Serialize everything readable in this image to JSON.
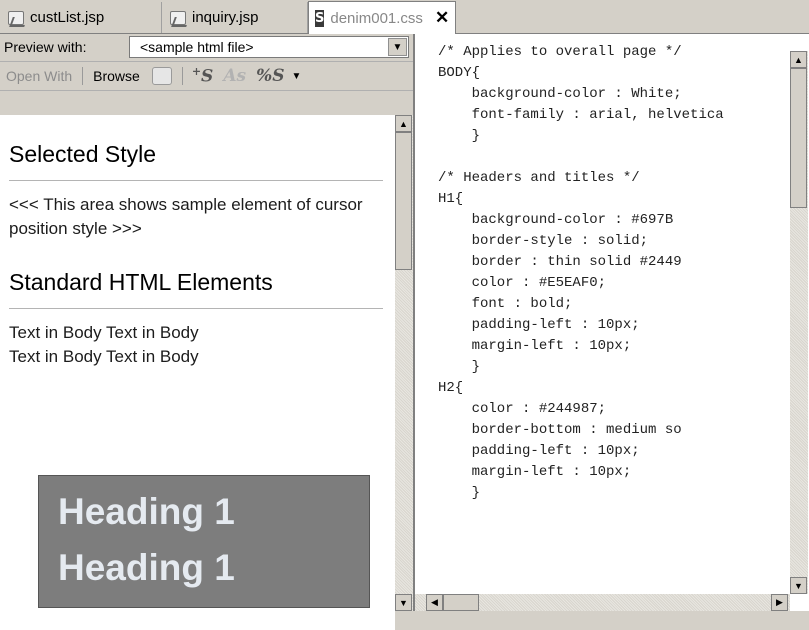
{
  "tabs": [
    {
      "label": "custList.jsp",
      "icon": "jsp-file-icon",
      "active": false
    },
    {
      "label": "inquiry.jsp",
      "icon": "jsp-file-icon",
      "active": false
    },
    {
      "label": "denim001.css",
      "icon": "css-file-icon",
      "active": true
    }
  ],
  "close_glyph": "✕",
  "preview": {
    "label": "Preview with:",
    "select_value": "<sample html file>"
  },
  "toolbar": {
    "open_with": "Open With",
    "browse": "Browse"
  },
  "sample": {
    "selected_style_title": "Selected Style",
    "selected_style_text": "<<< This area shows sample element of cursor position style >>>",
    "standard_title": "Standard HTML Elements",
    "body_text_1": "Text in Body Text in Body",
    "body_text_2": "Text in Body Text in Body",
    "heading_1a": "Heading 1",
    "heading_1b": "Heading 1"
  },
  "code_lines": [
    "/* Applies to overall page */",
    "BODY{",
    "    background-color : White;",
    "    font-family : arial, helvetica",
    "    }",
    "",
    "/* Headers and titles */",
    "H1{",
    "    background-color : #697B",
    "    border-style : solid;",
    "    border : thin solid #2449",
    "    color : #E5EAF0;",
    "    font : bold;",
    "    padding-left : 10px;",
    "    margin-left : 10px;",
    "    }",
    "H2{",
    "    color : #244987;",
    "    border-bottom : medium so",
    "    padding-left : 10px;",
    "    margin-left : 10px;",
    "    }"
  ],
  "colors": {
    "heading_bg": "#7d7d7d",
    "heading_text": "#E5EAF0",
    "chrome": "#d4d0c8"
  }
}
